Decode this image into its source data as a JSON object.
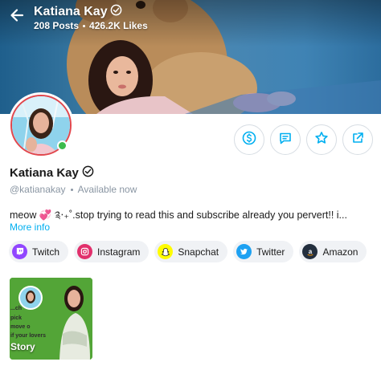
{
  "header": {
    "title": "Katiana Kay",
    "posts": "208 Posts",
    "likes": "426.2K Likes"
  },
  "profile": {
    "name": "Katiana Kay",
    "handle": "@katianakay",
    "status": "Available now",
    "bio": "meow 💞 ༉‧₊˚.stop trying to read this and subscribe already you pervert!! i...",
    "more_info": "More info"
  },
  "socials": [
    {
      "label": "Twitch",
      "color": "#9146ff"
    },
    {
      "label": "Instagram",
      "color": "#e1306c"
    },
    {
      "label": "Snapchat",
      "color": "#fffc00"
    },
    {
      "label": "Twitter",
      "color": "#1da1f2"
    },
    {
      "label": "Amazon",
      "color": "#232f3e"
    }
  ],
  "story": {
    "label": "Story",
    "overlay_text": "...ch",
    "overlay_lines": [
      "pick",
      "move o",
      "if your lovers"
    ]
  },
  "colors": {
    "accent": "#00aff0",
    "avatar_ring": "#e2474d",
    "online": "#3dbb4d"
  }
}
